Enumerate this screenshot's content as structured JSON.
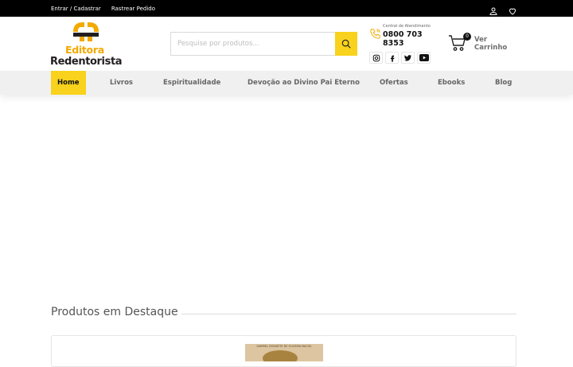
{
  "topbar": {
    "login_label": "Entrar / Cadastrar",
    "track_label": "Rastrear Pedido"
  },
  "logo": {
    "line1": "Editora",
    "line2": "Redentorista"
  },
  "search": {
    "placeholder": "Pesquise por produtos...",
    "value": ""
  },
  "contact": {
    "label": "Central de Atendimento",
    "phone": "0800 703 8353"
  },
  "social": [
    "instagram-icon",
    "facebook-icon",
    "twitter-icon",
    "youtube-icon"
  ],
  "cart": {
    "count": "0",
    "label": "Ver Carrinho"
  },
  "nav": {
    "items": [
      {
        "label": "Home",
        "active": true
      },
      {
        "label": "Livros"
      },
      {
        "label": "Espiritualidade"
      },
      {
        "label": "Devoção ao Divino Pai Eterno"
      },
      {
        "label": "Ofertas"
      },
      {
        "label": "Ebooks"
      },
      {
        "label": "Blog"
      }
    ]
  },
  "featured": {
    "title": "Produtos em Destaque",
    "product_cover_text": "GABRIEL DONIZETE DE OLIVEIRA MACIEL"
  },
  "colors": {
    "accent": "#f8d21c",
    "logo_orange": "#f2a900",
    "topbar": "#000000"
  }
}
